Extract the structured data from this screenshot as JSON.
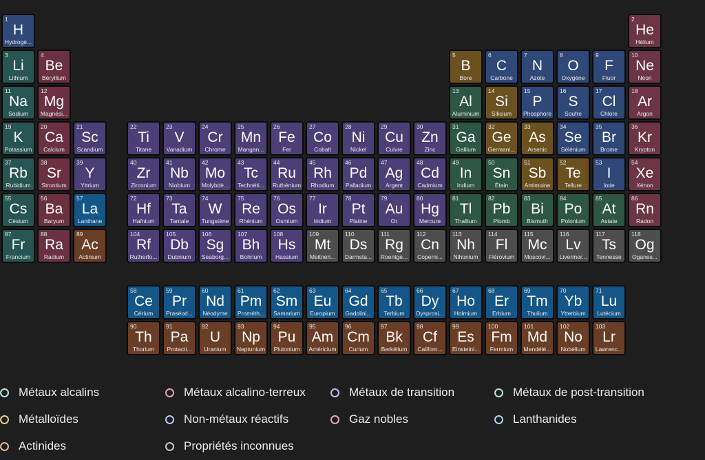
{
  "categories": {
    "alkali": {
      "fill": "#275554",
      "dot": "#b7e7e3"
    },
    "alkaline": {
      "fill": "#6b3142",
      "dot": "#e8a3b5"
    },
    "transition": {
      "fill": "#4b3f78",
      "dot": "#c8bdf0"
    },
    "post": {
      "fill": "#2d5644",
      "dot": "#b5e6ce"
    },
    "metalloid": {
      "fill": "#6b5120",
      "dot": "#ebcd8c"
    },
    "nonmetal": {
      "fill": "#2f4878",
      "dot": "#b7c7ef"
    },
    "noble": {
      "fill": "#6c3445",
      "dot": "#eaa6b9"
    },
    "lanthanide": {
      "fill": "#145687",
      "dot": "#a4d7f4"
    },
    "actinide": {
      "fill": "#6a3e26",
      "dot": "#eab595"
    },
    "unknown": {
      "fill": "#4d4d4d",
      "dot": "#c6c6c6"
    }
  },
  "elements": [
    {
      "n": "1",
      "s": "H",
      "name": "Hydrogè...",
      "c": "nonmetal",
      "r": 1,
      "g": 1
    },
    {
      "n": "2",
      "s": "He",
      "name": "Hélium",
      "c": "noble",
      "r": 1,
      "g": 18
    },
    {
      "n": "3",
      "s": "Li",
      "name": "Lithium",
      "c": "alkali",
      "r": 2,
      "g": 1
    },
    {
      "n": "4",
      "s": "Be",
      "name": "Béryllium",
      "c": "alkaline",
      "r": 2,
      "g": 2
    },
    {
      "n": "5",
      "s": "B",
      "name": "Bore",
      "c": "metalloid",
      "r": 2,
      "g": 13
    },
    {
      "n": "6",
      "s": "C",
      "name": "Carbone",
      "c": "nonmetal",
      "r": 2,
      "g": 14
    },
    {
      "n": "7",
      "s": "N",
      "name": "Azote",
      "c": "nonmetal",
      "r": 2,
      "g": 15
    },
    {
      "n": "8",
      "s": "O",
      "name": "Oxygène",
      "c": "nonmetal",
      "r": 2,
      "g": 16
    },
    {
      "n": "9",
      "s": "F",
      "name": "Fluor",
      "c": "nonmetal",
      "r": 2,
      "g": 17
    },
    {
      "n": "10",
      "s": "Ne",
      "name": "Néon",
      "c": "noble",
      "r": 2,
      "g": 18
    },
    {
      "n": "11",
      "s": "Na",
      "name": "Sodium",
      "c": "alkali",
      "r": 3,
      "g": 1
    },
    {
      "n": "12",
      "s": "Mg",
      "name": "Magnési...",
      "c": "alkaline",
      "r": 3,
      "g": 2
    },
    {
      "n": "13",
      "s": "Al",
      "name": "Aluminium",
      "c": "post",
      "r": 3,
      "g": 13
    },
    {
      "n": "14",
      "s": "Si",
      "name": "Silicium",
      "c": "metalloid",
      "r": 3,
      "g": 14
    },
    {
      "n": "15",
      "s": "P",
      "name": "Phosphore",
      "c": "nonmetal",
      "r": 3,
      "g": 15
    },
    {
      "n": "16",
      "s": "S",
      "name": "Soufre",
      "c": "nonmetal",
      "r": 3,
      "g": 16
    },
    {
      "n": "17",
      "s": "Cl",
      "name": "Chlore",
      "c": "nonmetal",
      "r": 3,
      "g": 17
    },
    {
      "n": "18",
      "s": "Ar",
      "name": "Argon",
      "c": "noble",
      "r": 3,
      "g": 18
    },
    {
      "n": "19",
      "s": "K",
      "name": "Potassium",
      "c": "alkali",
      "r": 4,
      "g": 1
    },
    {
      "n": "20",
      "s": "Ca",
      "name": "Calcium",
      "c": "alkaline",
      "r": 4,
      "g": 2
    },
    {
      "n": "21",
      "s": "Sc",
      "name": "Scandium",
      "c": "transition",
      "r": 4,
      "g": 3
    },
    {
      "n": "22",
      "s": "Ti",
      "name": "Titane",
      "c": "transition",
      "r": 4,
      "g": 4
    },
    {
      "n": "23",
      "s": "V",
      "name": "Vanadium",
      "c": "transition",
      "r": 4,
      "g": 5
    },
    {
      "n": "24",
      "s": "Cr",
      "name": "Chrome",
      "c": "transition",
      "r": 4,
      "g": 6
    },
    {
      "n": "25",
      "s": "Mn",
      "name": "Mangan...",
      "c": "transition",
      "r": 4,
      "g": 7
    },
    {
      "n": "26",
      "s": "Fe",
      "name": "Fer",
      "c": "transition",
      "r": 4,
      "g": 8
    },
    {
      "n": "27",
      "s": "Co",
      "name": "Cobalt",
      "c": "transition",
      "r": 4,
      "g": 9
    },
    {
      "n": "28",
      "s": "Ni",
      "name": "Nickel",
      "c": "transition",
      "r": 4,
      "g": 10
    },
    {
      "n": "29",
      "s": "Cu",
      "name": "Cuivre",
      "c": "transition",
      "r": 4,
      "g": 11
    },
    {
      "n": "30",
      "s": "Zn",
      "name": "Zinc",
      "c": "transition",
      "r": 4,
      "g": 12
    },
    {
      "n": "31",
      "s": "Ga",
      "name": "Gallium",
      "c": "post",
      "r": 4,
      "g": 13
    },
    {
      "n": "32",
      "s": "Ge",
      "name": "Germani...",
      "c": "metalloid",
      "r": 4,
      "g": 14
    },
    {
      "n": "33",
      "s": "As",
      "name": "Arsenic",
      "c": "metalloid",
      "r": 4,
      "g": 15
    },
    {
      "n": "34",
      "s": "Se",
      "name": "Sélénium",
      "c": "nonmetal",
      "r": 4,
      "g": 16
    },
    {
      "n": "35",
      "s": "Br",
      "name": "Brome",
      "c": "nonmetal",
      "r": 4,
      "g": 17
    },
    {
      "n": "36",
      "s": "Kr",
      "name": "Krypton",
      "c": "noble",
      "r": 4,
      "g": 18
    },
    {
      "n": "37",
      "s": "Rb",
      "name": "Rubidium",
      "c": "alkali",
      "r": 5,
      "g": 1
    },
    {
      "n": "38",
      "s": "Sr",
      "name": "Strontium",
      "c": "alkaline",
      "r": 5,
      "g": 2
    },
    {
      "n": "39",
      "s": "Y",
      "name": "Yttrium",
      "c": "transition",
      "r": 5,
      "g": 3
    },
    {
      "n": "40",
      "s": "Zr",
      "name": "Zirconium",
      "c": "transition",
      "r": 5,
      "g": 4
    },
    {
      "n": "41",
      "s": "Nb",
      "name": "Niobium",
      "c": "transition",
      "r": 5,
      "g": 5
    },
    {
      "n": "42",
      "s": "Mo",
      "name": "Molybdè...",
      "c": "transition",
      "r": 5,
      "g": 6
    },
    {
      "n": "43",
      "s": "Tc",
      "name": "Technéti...",
      "c": "transition",
      "r": 5,
      "g": 7
    },
    {
      "n": "44",
      "s": "Ru",
      "name": "Ruthénium",
      "c": "transition",
      "r": 5,
      "g": 8
    },
    {
      "n": "45",
      "s": "Rh",
      "name": "Rhodium",
      "c": "transition",
      "r": 5,
      "g": 9
    },
    {
      "n": "46",
      "s": "Pd",
      "name": "Palladium",
      "c": "transition",
      "r": 5,
      "g": 10
    },
    {
      "n": "47",
      "s": "Ag",
      "name": "Argent",
      "c": "transition",
      "r": 5,
      "g": 11
    },
    {
      "n": "48",
      "s": "Cd",
      "name": "Cadmium",
      "c": "transition",
      "r": 5,
      "g": 12
    },
    {
      "n": "49",
      "s": "In",
      "name": "Indium",
      "c": "post",
      "r": 5,
      "g": 13
    },
    {
      "n": "50",
      "s": "Sn",
      "name": "Étain",
      "c": "post",
      "r": 5,
      "g": 14
    },
    {
      "n": "51",
      "s": "Sb",
      "name": "Antimoine",
      "c": "metalloid",
      "r": 5,
      "g": 15
    },
    {
      "n": "52",
      "s": "Te",
      "name": "Tellure",
      "c": "metalloid",
      "r": 5,
      "g": 16
    },
    {
      "n": "53",
      "s": "I",
      "name": "Iode",
      "c": "nonmetal",
      "r": 5,
      "g": 17
    },
    {
      "n": "54",
      "s": "Xe",
      "name": "Xénon",
      "c": "noble",
      "r": 5,
      "g": 18
    },
    {
      "n": "55",
      "s": "Cs",
      "name": "Césium",
      "c": "alkali",
      "r": 6,
      "g": 1
    },
    {
      "n": "56",
      "s": "Ba",
      "name": "Baryum",
      "c": "alkaline",
      "r": 6,
      "g": 2
    },
    {
      "n": "57",
      "s": "La",
      "name": "Lanthane",
      "c": "lanthanide",
      "r": 6,
      "g": 3
    },
    {
      "n": "72",
      "s": "Hf",
      "name": "Hafnium",
      "c": "transition",
      "r": 6,
      "g": 4
    },
    {
      "n": "73",
      "s": "Ta",
      "name": "Tantale",
      "c": "transition",
      "r": 6,
      "g": 5
    },
    {
      "n": "74",
      "s": "W",
      "name": "Tungstène",
      "c": "transition",
      "r": 6,
      "g": 6
    },
    {
      "n": "75",
      "s": "Re",
      "name": "Rhénium",
      "c": "transition",
      "r": 6,
      "g": 7
    },
    {
      "n": "76",
      "s": "Os",
      "name": "Osmium",
      "c": "transition",
      "r": 6,
      "g": 8
    },
    {
      "n": "77",
      "s": "Ir",
      "name": "Iridium",
      "c": "transition",
      "r": 6,
      "g": 9
    },
    {
      "n": "78",
      "s": "Pt",
      "name": "Platine",
      "c": "transition",
      "r": 6,
      "g": 10
    },
    {
      "n": "79",
      "s": "Au",
      "name": "Or",
      "c": "transition",
      "r": 6,
      "g": 11
    },
    {
      "n": "80",
      "s": "Hg",
      "name": "Mercure",
      "c": "transition",
      "r": 6,
      "g": 12
    },
    {
      "n": "81",
      "s": "Tl",
      "name": "Thallium",
      "c": "post",
      "r": 6,
      "g": 13
    },
    {
      "n": "82",
      "s": "Pb",
      "name": "Plomb",
      "c": "post",
      "r": 6,
      "g": 14
    },
    {
      "n": "83",
      "s": "Bi",
      "name": "Bismuth",
      "c": "post",
      "r": 6,
      "g": 15
    },
    {
      "n": "84",
      "s": "Po",
      "name": "Polonium",
      "c": "post",
      "r": 6,
      "g": 16
    },
    {
      "n": "85",
      "s": "At",
      "name": "Astate",
      "c": "post",
      "r": 6,
      "g": 17
    },
    {
      "n": "86",
      "s": "Rn",
      "name": "Radon",
      "c": "noble",
      "r": 6,
      "g": 18
    },
    {
      "n": "87",
      "s": "Fr",
      "name": "Francium",
      "c": "alkali",
      "r": 7,
      "g": 1
    },
    {
      "n": "88",
      "s": "Ra",
      "name": "Radium",
      "c": "alkaline",
      "r": 7,
      "g": 2
    },
    {
      "n": "89",
      "s": "Ac",
      "name": "Actinium",
      "c": "actinide",
      "r": 7,
      "g": 3
    },
    {
      "n": "104",
      "s": "Rf",
      "name": "Rutherfo...",
      "c": "transition",
      "r": 7,
      "g": 4
    },
    {
      "n": "105",
      "s": "Db",
      "name": "Dubnium",
      "c": "transition",
      "r": 7,
      "g": 5
    },
    {
      "n": "106",
      "s": "Sg",
      "name": "Seaborg...",
      "c": "transition",
      "r": 7,
      "g": 6
    },
    {
      "n": "107",
      "s": "Bh",
      "name": "Bohrium",
      "c": "transition",
      "r": 7,
      "g": 7
    },
    {
      "n": "108",
      "s": "Hs",
      "name": "Hassium",
      "c": "transition",
      "r": 7,
      "g": 8
    },
    {
      "n": "109",
      "s": "Mt",
      "name": "Meitnéri...",
      "c": "unknown",
      "r": 7,
      "g": 9
    },
    {
      "n": "110",
      "s": "Ds",
      "name": "Darmsta...",
      "c": "unknown",
      "r": 7,
      "g": 10
    },
    {
      "n": "111",
      "s": "Rg",
      "name": "Roentge...",
      "c": "unknown",
      "r": 7,
      "g": 11
    },
    {
      "n": "112",
      "s": "Cn",
      "name": "Coperni...",
      "c": "unknown",
      "r": 7,
      "g": 12
    },
    {
      "n": "113",
      "s": "Nh",
      "name": "Nihonium",
      "c": "unknown",
      "r": 7,
      "g": 13
    },
    {
      "n": "114",
      "s": "Fl",
      "name": "Flérovium",
      "c": "unknown",
      "r": 7,
      "g": 14
    },
    {
      "n": "115",
      "s": "Mc",
      "name": "Moscovi...",
      "c": "unknown",
      "r": 7,
      "g": 15
    },
    {
      "n": "116",
      "s": "Lv",
      "name": "Livermor...",
      "c": "unknown",
      "r": 7,
      "g": 16
    },
    {
      "n": "117",
      "s": "Ts",
      "name": "Tennesse",
      "c": "unknown",
      "r": 7,
      "g": 17
    },
    {
      "n": "118",
      "s": "Og",
      "name": "Oganes...",
      "c": "unknown",
      "r": 7,
      "g": 18
    },
    {
      "n": "58",
      "s": "Ce",
      "name": "Cérium",
      "c": "lanthanide",
      "r": 8,
      "g": 4
    },
    {
      "n": "59",
      "s": "Pr",
      "name": "Praséod...",
      "c": "lanthanide",
      "r": 8,
      "g": 5
    },
    {
      "n": "60",
      "s": "Nd",
      "name": "Néodyme",
      "c": "lanthanide",
      "r": 8,
      "g": 6
    },
    {
      "n": "61",
      "s": "Pm",
      "name": "Prométh...",
      "c": "lanthanide",
      "r": 8,
      "g": 7
    },
    {
      "n": "62",
      "s": "Sm",
      "name": "Samarium",
      "c": "lanthanide",
      "r": 8,
      "g": 8
    },
    {
      "n": "63",
      "s": "Eu",
      "name": "Europium",
      "c": "lanthanide",
      "r": 8,
      "g": 9
    },
    {
      "n": "64",
      "s": "Gd",
      "name": "Gadolini...",
      "c": "lanthanide",
      "r": 8,
      "g": 10
    },
    {
      "n": "65",
      "s": "Tb",
      "name": "Terbium",
      "c": "lanthanide",
      "r": 8,
      "g": 11
    },
    {
      "n": "66",
      "s": "Dy",
      "name": "Dysprosi...",
      "c": "lanthanide",
      "r": 8,
      "g": 12
    },
    {
      "n": "67",
      "s": "Ho",
      "name": "Holmium",
      "c": "lanthanide",
      "r": 8,
      "g": 13
    },
    {
      "n": "68",
      "s": "Er",
      "name": "Erbium",
      "c": "lanthanide",
      "r": 8,
      "g": 14
    },
    {
      "n": "69",
      "s": "Tm",
      "name": "Thulium",
      "c": "lanthanide",
      "r": 8,
      "g": 15
    },
    {
      "n": "70",
      "s": "Yb",
      "name": "Ytterbium",
      "c": "lanthanide",
      "r": 8,
      "g": 16
    },
    {
      "n": "71",
      "s": "Lu",
      "name": "Lutécium",
      "c": "lanthanide",
      "r": 8,
      "g": 17
    },
    {
      "n": "90",
      "s": "Th",
      "name": "Thorium",
      "c": "actinide",
      "r": 9,
      "g": 4
    },
    {
      "n": "91",
      "s": "Pa",
      "name": "Protacti...",
      "c": "actinide",
      "r": 9,
      "g": 5
    },
    {
      "n": "92",
      "s": "U",
      "name": "Uranium",
      "c": "actinide",
      "r": 9,
      "g": 6
    },
    {
      "n": "93",
      "s": "Np",
      "name": "Neptunium",
      "c": "actinide",
      "r": 9,
      "g": 7
    },
    {
      "n": "94",
      "s": "Pu",
      "name": "Plutonium",
      "c": "actinide",
      "r": 9,
      "g": 8
    },
    {
      "n": "95",
      "s": "Am",
      "name": "Américium",
      "c": "actinide",
      "r": 9,
      "g": 9
    },
    {
      "n": "96",
      "s": "Cm",
      "name": "Curium",
      "c": "actinide",
      "r": 9,
      "g": 10
    },
    {
      "n": "97",
      "s": "Bk",
      "name": "Berkélium",
      "c": "actinide",
      "r": 9,
      "g": 11
    },
    {
      "n": "98",
      "s": "Cf",
      "name": "Californ...",
      "c": "actinide",
      "r": 9,
      "g": 12
    },
    {
      "n": "99",
      "s": "Es",
      "name": "Einsteini...",
      "c": "actinide",
      "r": 9,
      "g": 13
    },
    {
      "n": "100",
      "s": "Fm",
      "name": "Fermium",
      "c": "actinide",
      "r": 9,
      "g": 14
    },
    {
      "n": "101",
      "s": "Md",
      "name": "Mendélé...",
      "c": "actinide",
      "r": 9,
      "g": 15
    },
    {
      "n": "102",
      "s": "No",
      "name": "Nobélium",
      "c": "actinide",
      "r": 9,
      "g": 16
    },
    {
      "n": "103",
      "s": "Lr",
      "name": "Lawrenc...",
      "c": "actinide",
      "r": 9,
      "g": 17
    }
  ],
  "legend": [
    {
      "label": "Métaux alcalins",
      "c": "alkali"
    },
    {
      "label": "Métaux alcalino-terreux",
      "c": "alkaline"
    },
    {
      "label": "Métaux de transition",
      "c": "transition"
    },
    {
      "label": "Métaux de post-transition",
      "c": "post"
    },
    {
      "label": "Métalloïdes",
      "c": "metalloid"
    },
    {
      "label": "Non-métaux réactifs",
      "c": "nonmetal"
    },
    {
      "label": "Gaz nobles",
      "c": "noble"
    },
    {
      "label": "Lanthanides",
      "c": "lanthanide"
    },
    {
      "label": "Actinides",
      "c": "actinide"
    },
    {
      "label": "Propriétés inconnues",
      "c": "unknown"
    }
  ]
}
